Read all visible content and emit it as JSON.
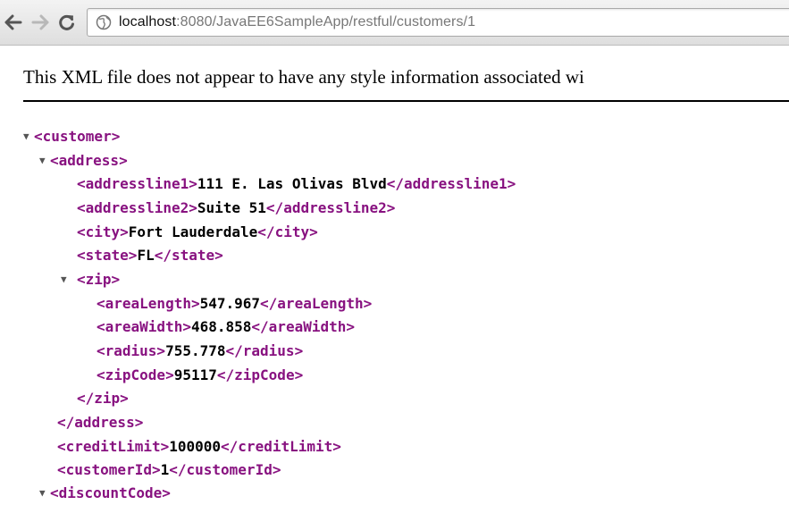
{
  "browser": {
    "url_host": "localhost",
    "url_rest": ":8080/JavaEE6SampleApp/restful/customers/1"
  },
  "info_message": "This XML file does not appear to have any style information associated wi",
  "xml": {
    "customer_open": "<customer>",
    "address_open": "<address>",
    "addressline1": {
      "open": "<addressline1>",
      "value": "111 E. Las Olivas Blvd",
      "close": "</addressline1>"
    },
    "addressline2": {
      "open": "<addressline2>",
      "value": "Suite 51",
      "close": "</addressline2>"
    },
    "city": {
      "open": "<city>",
      "value": "Fort Lauderdale",
      "close": "</city>"
    },
    "state": {
      "open": "<state>",
      "value": "FL",
      "close": "</state>"
    },
    "zip_open": "<zip>",
    "areaLength": {
      "open": "<areaLength>",
      "value": "547.967",
      "close": "</areaLength>"
    },
    "areaWidth": {
      "open": "<areaWidth>",
      "value": "468.858",
      "close": "</areaWidth>"
    },
    "radius": {
      "open": "<radius>",
      "value": "755.778",
      "close": "</radius>"
    },
    "zipCode": {
      "open": "<zipCode>",
      "value": "95117",
      "close": "</zipCode>"
    },
    "zip_close": "</zip>",
    "address_close": "</address>",
    "creditLimit": {
      "open": "<creditLimit>",
      "value": "100000",
      "close": "</creditLimit>"
    },
    "customerId": {
      "open": "<customerId>",
      "value": "1",
      "close": "</customerId>"
    },
    "discountCode_open": "<discountCode>"
  }
}
